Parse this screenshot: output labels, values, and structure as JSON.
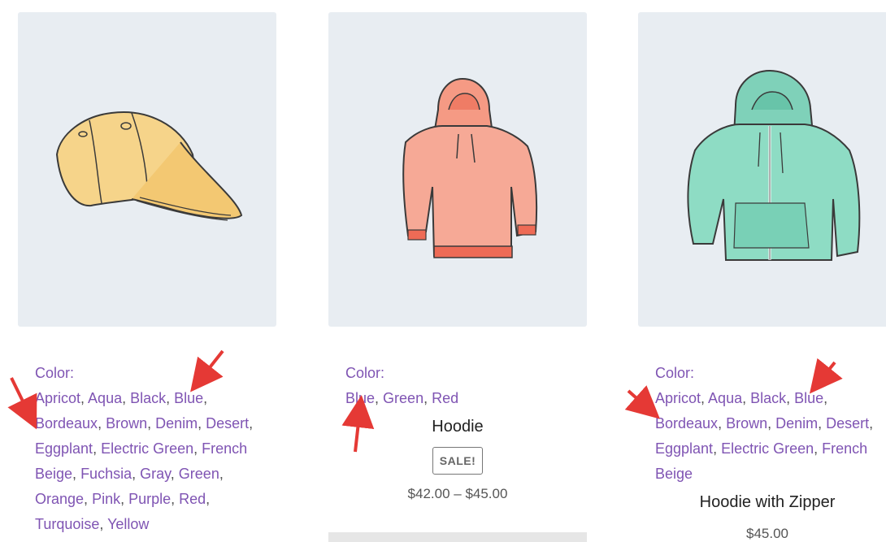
{
  "products": [
    {
      "attr_label": "Color:",
      "colors": [
        "Apricot",
        "Aqua",
        "Black",
        "Blue",
        "Bordeaux",
        "Brown",
        "Denim",
        "Desert",
        "Eggplant",
        "Electric Green",
        "French Beige",
        "Fuchsia",
        "Gray",
        "Green",
        "Orange",
        "Pink",
        "Purple",
        "Red",
        "Turquoise",
        "Yellow"
      ],
      "image_icon": "cap-icon"
    },
    {
      "attr_label": "Color:",
      "colors": [
        "Blue",
        "Green",
        "Red"
      ],
      "title": "Hoodie",
      "badge": "SALE!",
      "price": "$42.00 – $45.00",
      "image_icon": "hoodie-icon"
    },
    {
      "attr_label": "Color:",
      "colors": [
        "Apricot",
        "Aqua",
        "Black",
        "Blue",
        "Bordeaux",
        "Brown",
        "Denim",
        "Desert",
        "Eggplant",
        "Electric Green",
        "French Beige"
      ],
      "title": "Hoodie with Zipper",
      "price": "$45.00",
      "image_icon": "zip-hoodie-icon"
    }
  ],
  "colors": {
    "link": "#7f54b3",
    "thumb_bg": "#e8edf2",
    "annotation_arrow": "#e53935"
  }
}
